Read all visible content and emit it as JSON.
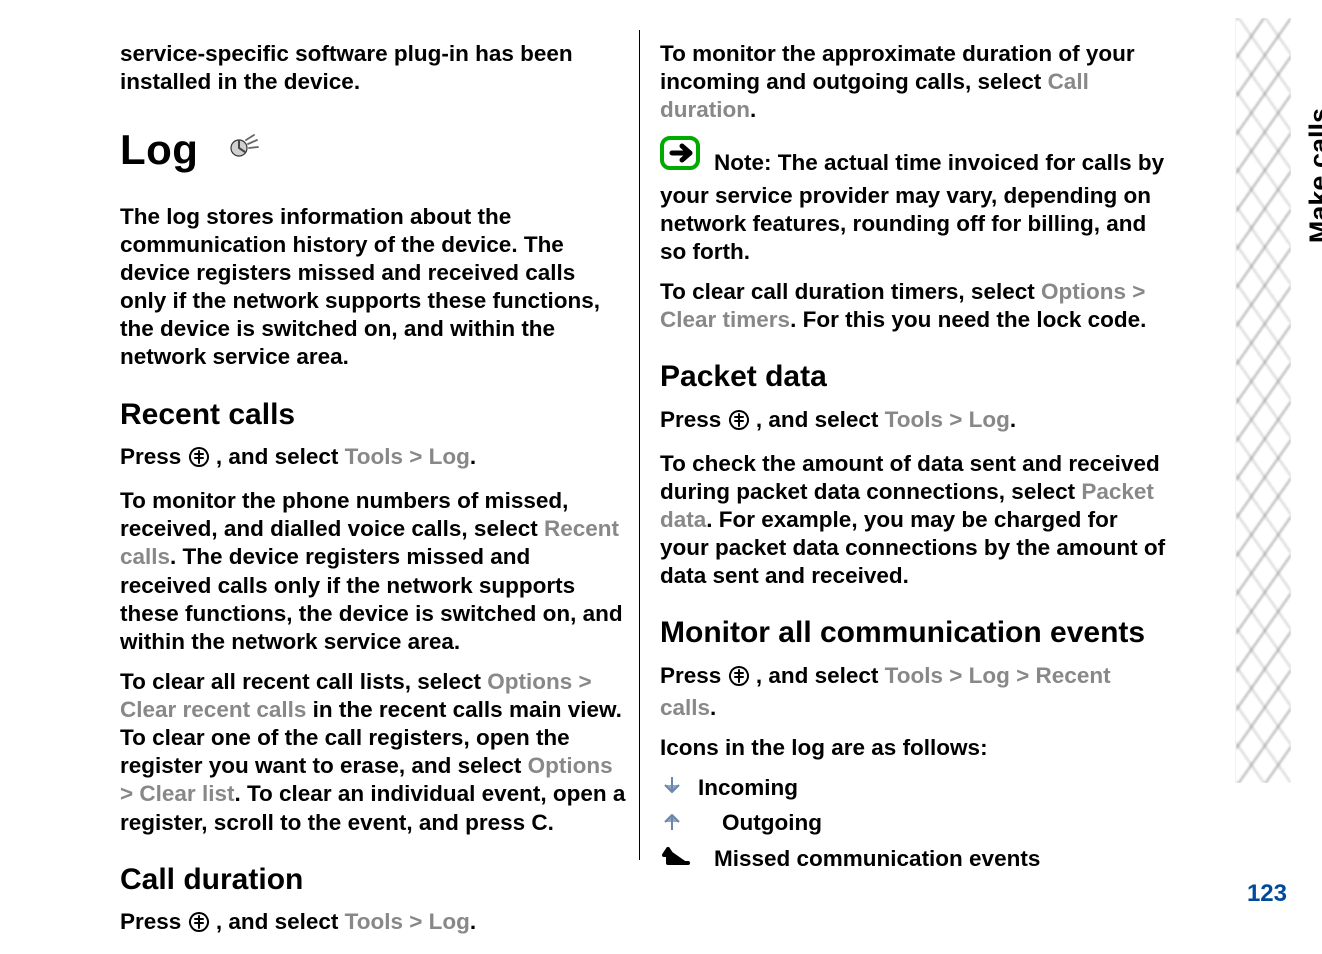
{
  "page": {
    "section": "Make calls",
    "number": "123"
  },
  "left": {
    "intro": "service-specific software plug-in has been installed in the device.",
    "log_heading": "Log",
    "log_para": "The log stores information about the communication history of the device. The device registers missed and received calls only if the network supports these functions, the device is switched on, and within the network service area.",
    "recent_calls_heading": "Recent calls",
    "rc_press_prefix": "Press ",
    "rc_press_mid": ", and select ",
    "menu_tools": "Tools",
    "menu_log": "Log",
    "period": ".",
    "rc_p2a": "To monitor the phone numbers of missed, received, and dialled voice calls, select ",
    "menu_recent_calls": "Recent calls",
    "rc_p2b": ". The device registers missed and received calls only if the network supports these functions, the device is switched on, and within the network service area.",
    "rc_p3a": "To clear all recent call lists, select ",
    "menu_options": "Options",
    "menu_clear_recent": "Clear recent calls",
    "rc_p3b": " in the recent calls main view. To clear one of the call registers, open the register you want to erase, and select ",
    "menu_clear_list": "Clear list",
    "rc_p3c": ". To clear an individual event, open a register, scroll to the event, and press ",
    "key_c": "C",
    "cd_heading": "Call duration",
    "cd_press_prefix": "Press ",
    "cd_press_mid": " , and select "
  },
  "right": {
    "cd_p1a": "To monitor the approximate duration of your incoming and outgoing calls, select ",
    "menu_call_duration": "Call duration",
    "note_label": "Note:",
    "note_text": "  The actual time invoiced for calls by your service provider may vary, depending on network features, rounding off for billing, and so forth.",
    "cd_p2a": "To clear call duration timers, select ",
    "menu_clear_timers": "Clear timers",
    "cd_p2b": ". For this you need the lock code.",
    "pd_heading": "Packet data",
    "pd_press_prefix": "Press ",
    "pd_press_mid": " , and select ",
    "pd_p1a": "To check the amount of data sent and received during packet data connections, select ",
    "menu_packet_data": "Packet data",
    "pd_p1b": ". For example, you may be charged for your packet data connections by the amount of data sent and received.",
    "mon_heading": "Monitor all communication events",
    "mon_press_prefix": "Press ",
    "mon_press_mid": ", and select ",
    "menu_recent_calls2": "Recent calls",
    "icons_intro": "Icons in the log are as follows:",
    "icon_incoming": "Incoming",
    "icon_outgoing": "Outgoing",
    "icon_missed": "Missed communication events"
  },
  "sep": " > "
}
